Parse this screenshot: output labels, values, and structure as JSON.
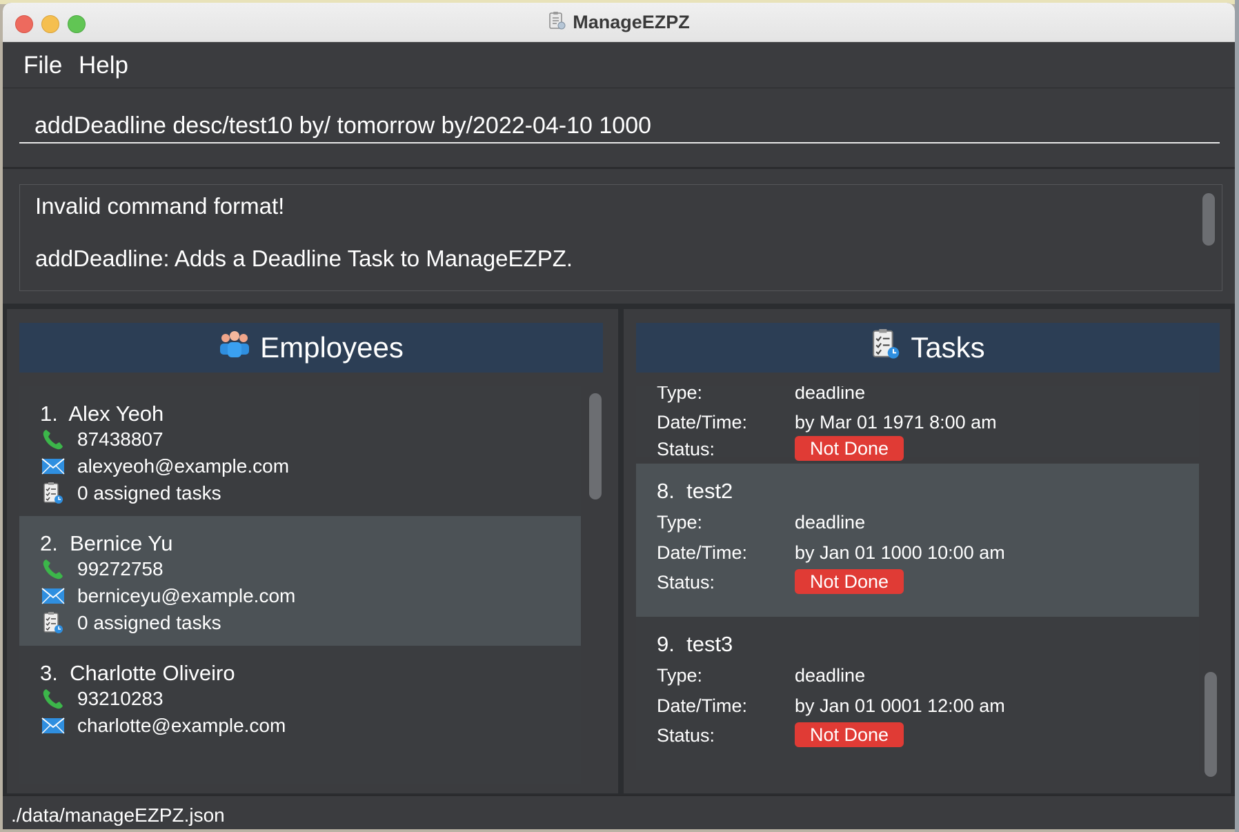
{
  "window": {
    "title": "ManageEZPZ"
  },
  "menu": {
    "file": "File",
    "help": "Help"
  },
  "command": {
    "value": "addDeadline desc/test10 by/ tomorrow by/2022-04-10 1000"
  },
  "result": {
    "line1": "Invalid command format!",
    "line2": "addDeadline: Adds a Deadline Task to ManageEZPZ."
  },
  "employees": {
    "header": "Employees",
    "items": [
      {
        "index": "1.",
        "name": "Alex Yeoh",
        "phone": "87438807",
        "email": "alexyeoh@example.com",
        "tasks": "0 assigned tasks"
      },
      {
        "index": "2.",
        "name": "Bernice Yu",
        "phone": "99272758",
        "email": "berniceyu@example.com",
        "tasks": "0 assigned tasks"
      },
      {
        "index": "3.",
        "name": "Charlotte Oliveiro",
        "phone": "93210283",
        "email": "charlotte@example.com"
      }
    ]
  },
  "tasks": {
    "header": "Tasks",
    "partial": {
      "type_label": "Type:",
      "type_value": "deadline",
      "datetime_label": "Date/Time:",
      "datetime_value": "by Mar 01 1971 8:00 am",
      "status_label": "Status:",
      "status_value": "Not Done"
    },
    "items": [
      {
        "index": "8.",
        "name": "test2",
        "type_label": "Type:",
        "type_value": "deadline",
        "datetime_label": "Date/Time:",
        "datetime_value": "by Jan 01 1000 10:00 am",
        "status_label": "Status:",
        "status_value": "Not Done"
      },
      {
        "index": "9.",
        "name": "test3",
        "type_label": "Type:",
        "type_value": "deadline",
        "datetime_label": "Date/Time:",
        "datetime_value": "by Jan 01 0001 12:00 am",
        "status_label": "Status:",
        "status_value": "Not Done"
      }
    ]
  },
  "status": {
    "path": "./data/manageEZPZ.json"
  },
  "colors": {
    "accent_header": "#2c3e55",
    "badge_red": "#e03b35",
    "phone_green": "#3cb64a",
    "mail_blue": "#2f8fe0"
  },
  "icons": [
    "app-icon",
    "people-icon",
    "tasklist-icon",
    "phone-icon",
    "mail-icon"
  ]
}
